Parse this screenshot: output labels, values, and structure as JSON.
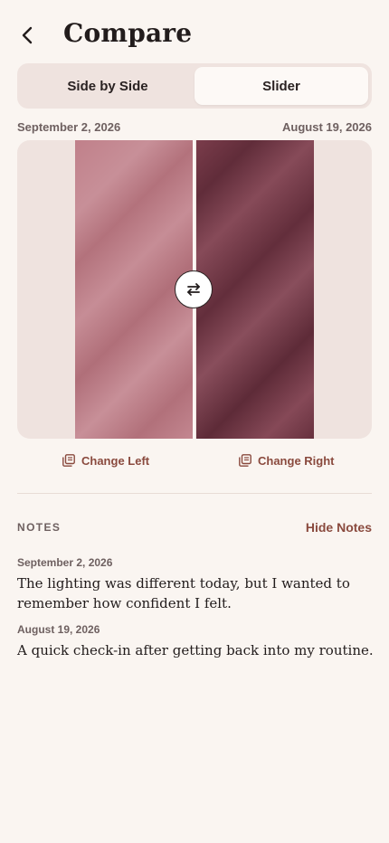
{
  "header": {
    "title": "Compare",
    "back_icon": "chevron-left-icon"
  },
  "view_toggle": {
    "options": [
      "Side by Side",
      "Slider"
    ],
    "selected": "Slider"
  },
  "compare": {
    "left_date": "September 2, 2026",
    "right_date": "August 19, 2026",
    "slider_position": 0.5,
    "handle_icon": "swap-horizontal-icon"
  },
  "actions": {
    "change_left": "Change Left",
    "change_right": "Change Right",
    "icon": "photo-library-icon"
  },
  "notes": {
    "label": "NOTES",
    "toggle_label": "Hide Notes",
    "items": [
      {
        "date": "September 2, 2026",
        "text": "The lighting was different today, but I wanted to remember how confident I felt."
      },
      {
        "date": "August 19, 2026",
        "text": "A quick check-in after getting back into my routine."
      }
    ]
  },
  "colors": {
    "accent": "#8a4a3e",
    "background": "#faf5f1",
    "segment_bg": "#efe3df"
  }
}
